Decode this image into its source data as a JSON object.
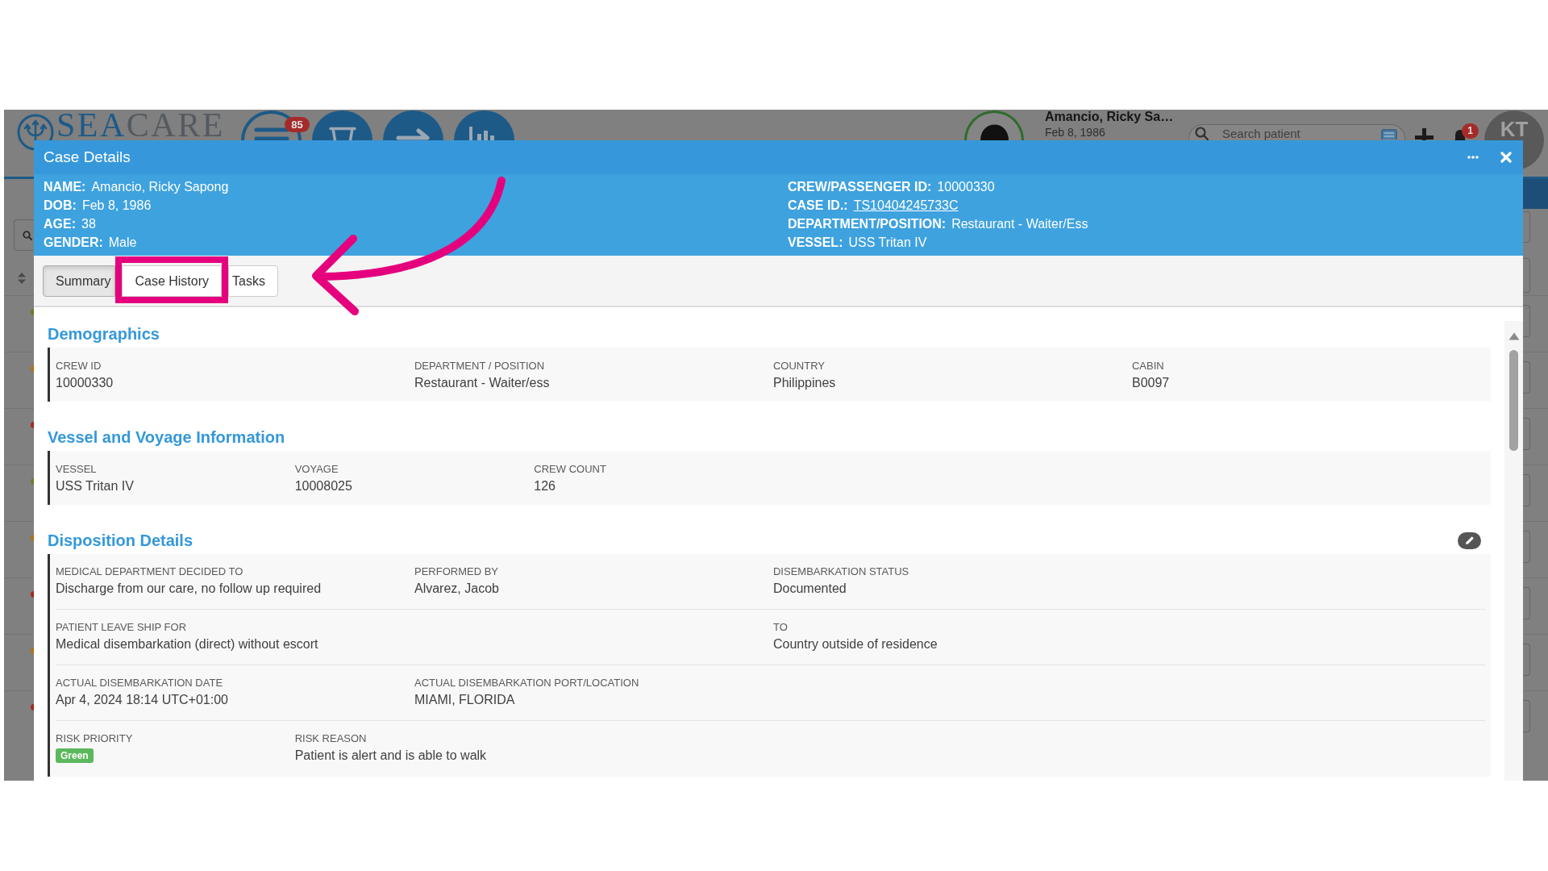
{
  "background_app": {
    "logo": {
      "parts": [
        "SEA",
        "CARE"
      ]
    },
    "nav_buttons": [
      {
        "kind": "menu",
        "badge": "85"
      },
      {
        "kind": "cup"
      },
      {
        "kind": "arrow"
      },
      {
        "kind": "chart"
      }
    ],
    "patient": {
      "name": "Amancio, Ricky Sa…",
      "dob": "Feb 8, 1986"
    },
    "search": {
      "placeholder": "Search patient"
    },
    "notifications": {
      "badge": "1"
    },
    "user": {
      "initials": "KT"
    },
    "list_rows": [
      {
        "color": "#6b7d2c"
      },
      {
        "color": "#b0711c"
      },
      {
        "color": "#a3291f"
      },
      {
        "color": "#6b7d2c"
      },
      {
        "color": "#b0711c"
      },
      {
        "color": "#a3291f"
      },
      {
        "color": "#b0711c"
      },
      {
        "color": "#a3291f"
      }
    ]
  },
  "case_dialog": {
    "title": "Case Details",
    "patient_info": {
      "left": [
        {
          "label": "NAME:",
          "value": "Amancio, Ricky Sapong",
          "kind": "text"
        },
        {
          "label": "DOB:",
          "value": "Feb 8, 1986",
          "kind": "text"
        },
        {
          "label": "AGE:",
          "value": "38",
          "kind": "text"
        },
        {
          "label": "GENDER:",
          "value": "Male",
          "kind": "text"
        }
      ],
      "right": [
        {
          "label": "CREW/PASSENGER ID:",
          "value": "10000330",
          "kind": "text"
        },
        {
          "label": "CASE ID.:",
          "value": "TS10404245733C",
          "kind": "link"
        },
        {
          "label": "DEPARTMENT/POSITION:",
          "value": "Restaurant - Waiter/Ess",
          "kind": "text"
        },
        {
          "label": "VESSEL:",
          "value": "USS Tritan IV",
          "kind": "text"
        }
      ]
    },
    "tabs": [
      {
        "label": "Summary",
        "selected": true,
        "highlighted": false
      },
      {
        "label": "Case History",
        "selected": false,
        "highlighted": true
      },
      {
        "label": "Tasks",
        "selected": false,
        "highlighted": false
      }
    ],
    "sections": [
      {
        "title": "Demographics",
        "editable": false,
        "rows": [
          {
            "fields": [
              {
                "label": "CREW ID",
                "value": "10000330",
                "kind": "text"
              },
              {
                "label": "DEPARTMENT / POSITION",
                "value": "Restaurant - Waiter/ess",
                "kind": "text"
              },
              {
                "label": "COUNTRY",
                "value": "Philippines",
                "kind": "text"
              },
              {
                "label": "CABIN",
                "value": "B0097",
                "kind": "text"
              }
            ]
          }
        ]
      },
      {
        "title": "Vessel and Voyage Information",
        "editable": false,
        "rows": [
          {
            "fields": [
              {
                "label": "VESSEL",
                "value": "USS Tritan IV",
                "kind": "text"
              },
              {
                "label": "VOYAGE",
                "value": "10008025",
                "kind": "text"
              },
              {
                "label": "CREW COUNT",
                "value": "126",
                "kind": "text"
              }
            ]
          }
        ]
      },
      {
        "title": "Disposition Details",
        "editable": true,
        "rows": [
          {
            "fields": [
              {
                "label": "MEDICAL DEPARTMENT DECIDED TO",
                "value": "Discharge from our care, no follow up required",
                "kind": "text"
              },
              {
                "label": "PERFORMED BY",
                "value": "Alvarez, Jacob",
                "kind": "text"
              },
              {
                "label": "DISEMBARKATION STATUS",
                "value": "Documented",
                "kind": "text"
              }
            ]
          },
          {
            "fields": [
              {
                "label": "PATIENT LEAVE SHIP FOR",
                "value": "Medical disembarkation (direct) without escort",
                "kind": "text"
              },
              {
                "label": "TO",
                "value": "Country outside of residence",
                "kind": "text"
              }
            ]
          },
          {
            "fields": [
              {
                "label": "ACTUAL DISEMBARKATION DATE",
                "value": "Apr 4, 2024 18:14 UTC+01:00",
                "kind": "text"
              },
              {
                "label": "ACTUAL DISEMBARKATION PORT/LOCATION",
                "value": "MIAMI, FLORIDA",
                "kind": "text"
              }
            ]
          },
          {
            "fields": [
              {
                "label": "RISK PRIORITY",
                "value": "Green",
                "kind": "badge",
                "color": "#5cb85c"
              },
              {
                "label": "RISK REASON",
                "value": "Patient is alert and is able to walk",
                "kind": "text"
              }
            ]
          }
        ]
      }
    ]
  },
  "annotations": [
    {
      "kind": "curved_arrow"
    }
  ]
}
